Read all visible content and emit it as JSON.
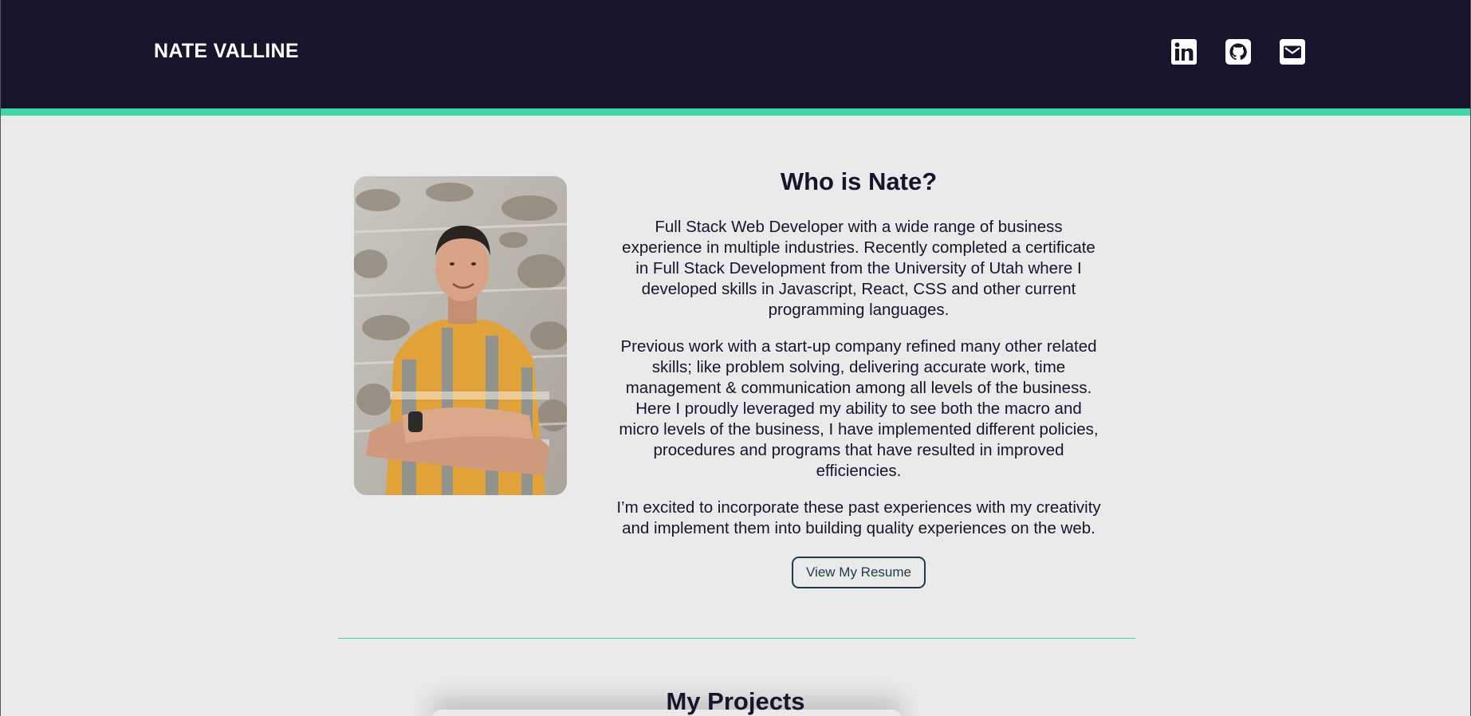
{
  "header": {
    "brand": "NATE VALLINE",
    "social": [
      {
        "name": "linkedin-icon"
      },
      {
        "name": "github-icon"
      },
      {
        "name": "email-icon"
      }
    ]
  },
  "about": {
    "title": "Who is Nate?",
    "paragraphs": [
      "Full Stack Web Developer with a wide range of business experience in multiple industries. Recently completed a certificate in Full Stack Development from the University of Utah where I developed skills in Javascript, React, CSS and other current programming languages.",
      "Previous work with a start-up company refined many other related skills; like problem solving, delivering accurate work, time management & communication among all levels of the business. Here I proudly leveraged my ability to see both the macro and micro levels of the business, I have implemented different policies, procedures and programs that have resulted in improved efficiencies.",
      "I’m excited to incorporate these past experiences with my creativity and implement them into building quality experiences on the web."
    ],
    "resume_button": "View My Resume"
  },
  "projects": {
    "title": "My Projects"
  },
  "colors": {
    "header_bg": "#16152b",
    "accent": "#3ed6a6",
    "page_bg": "#eaeaea",
    "text": "#16152b",
    "button_border": "#1f3b47"
  }
}
